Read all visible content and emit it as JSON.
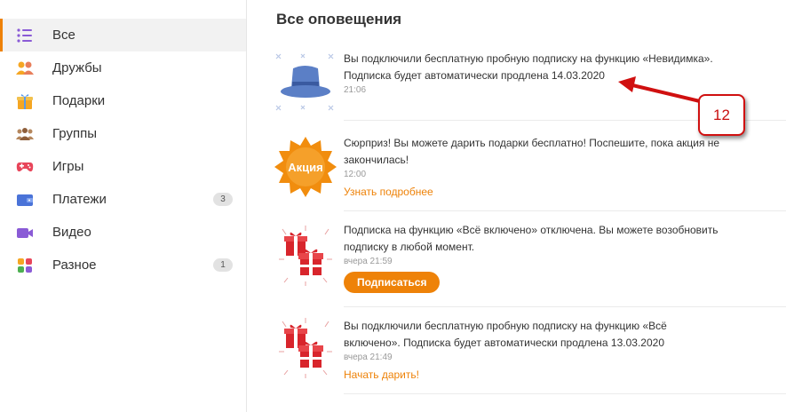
{
  "sidebar": {
    "items": [
      {
        "label": "Все",
        "icon": "list-icon",
        "active": true
      },
      {
        "label": "Дружбы",
        "icon": "friends-icon"
      },
      {
        "label": "Подарки",
        "icon": "gift-icon"
      },
      {
        "label": "Группы",
        "icon": "groups-icon"
      },
      {
        "label": "Игры",
        "icon": "gamepad-icon"
      },
      {
        "label": "Платежи",
        "icon": "wallet-icon",
        "count": "3"
      },
      {
        "label": "Видео",
        "icon": "video-camera-icon"
      },
      {
        "label": "Разное",
        "icon": "misc-icon",
        "count": "1"
      }
    ]
  },
  "main": {
    "title": "Все оповещения",
    "notifications": [
      {
        "text": "Вы подключили бесплатную пробную подписку на функцию «Невидимка». Подписка будет автоматически продлена 14.03.2020",
        "time": "21:06",
        "image": "hat-icon"
      },
      {
        "text": "Сюрприз! Вы можете дарить подарки бесплатно! Поспешите, пока акция не закончилась!",
        "time": "12:00",
        "link": "Узнать подробнее",
        "image": "promo-badge-icon",
        "badge_text": "Акция"
      },
      {
        "text": "Подписка на функцию «Всё включено» отключена. Вы можете возобновить подписку в любой момент.",
        "time": "вчера 21:59",
        "button": "Подписаться",
        "image": "gifts-icon"
      },
      {
        "text": "Вы подключили бесплатную пробную подписку на функцию «Всё включено». Подписка будет автоматически продлена 13.03.2020",
        "time": "вчера 21:49",
        "link": "Начать дарить!",
        "image": "gifts-icon"
      }
    ]
  },
  "annotation": {
    "label": "12",
    "color": "#d01010"
  },
  "colors": {
    "accent": "#ee8208",
    "hat": "#5b7fc6",
    "gift": "#d8252c"
  }
}
